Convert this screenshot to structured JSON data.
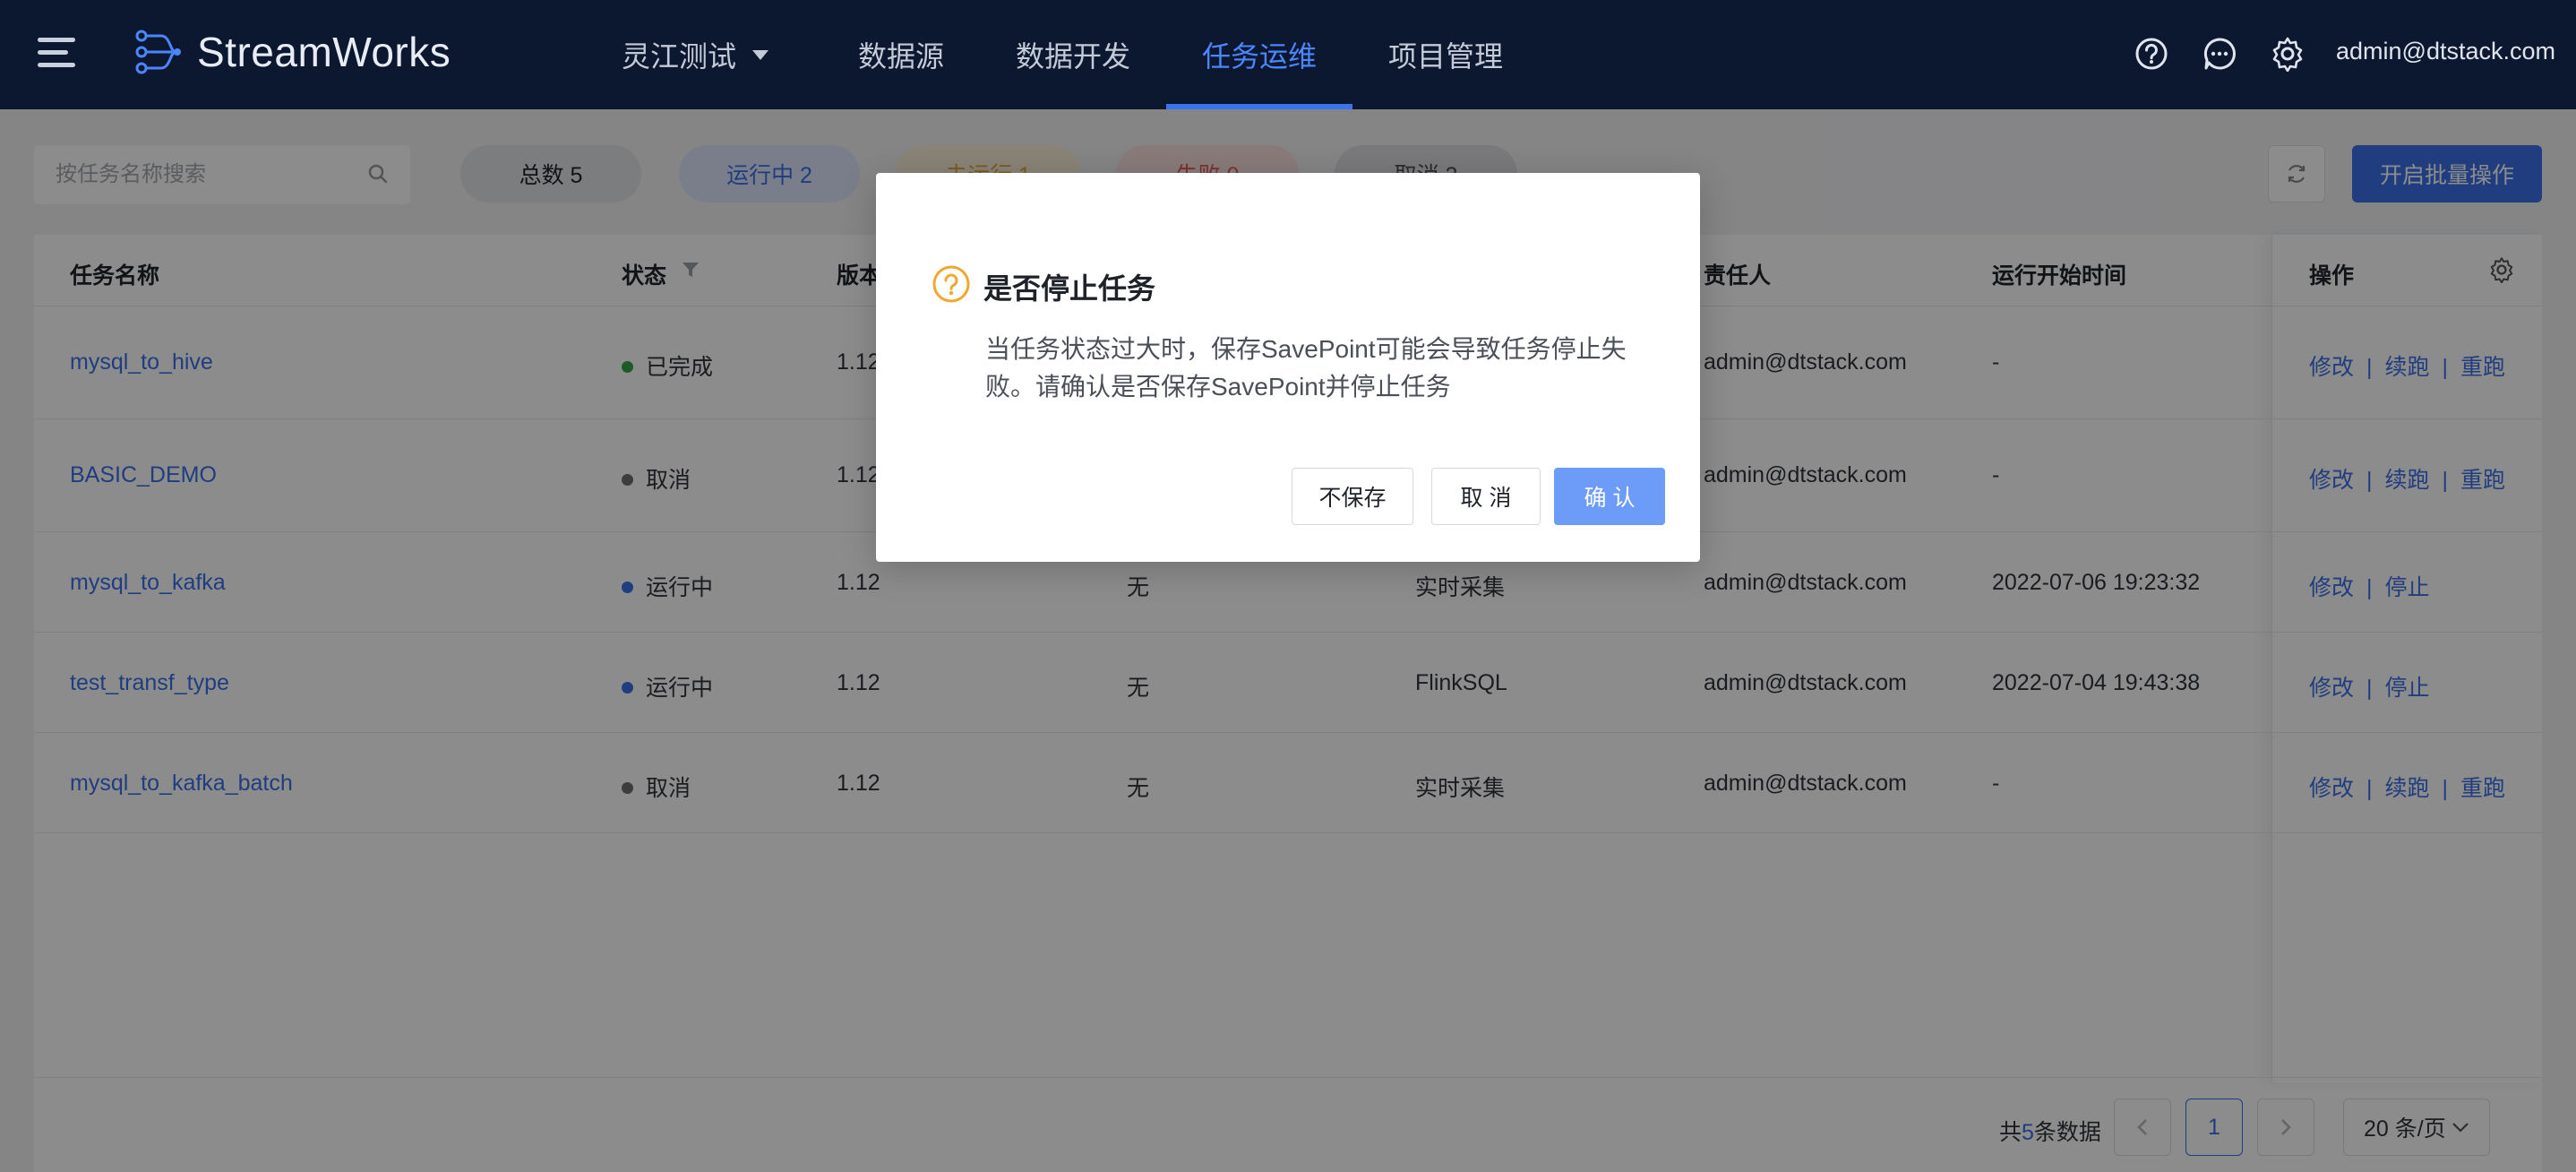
{
  "app": {
    "name": "StreamWorks",
    "user": "admin@dtstack.com"
  },
  "nav": {
    "project": "灵江测试",
    "items": [
      {
        "label": "数据源",
        "active": false
      },
      {
        "label": "数据开发",
        "active": false
      },
      {
        "label": "任务运维",
        "active": true
      },
      {
        "label": "项目管理",
        "active": false
      }
    ]
  },
  "toolbar": {
    "search_placeholder": "按任务名称搜索",
    "filters": [
      {
        "label": "总数 5"
      },
      {
        "label": "运行中 2"
      },
      {
        "label": "未运行 1"
      },
      {
        "label": "失败 0"
      },
      {
        "label": "取消 2"
      }
    ],
    "batch_label": "开启批量操作"
  },
  "table": {
    "columns": [
      "任务名称",
      "状态",
      "版本",
      "责任人",
      "运行开始时间",
      "操作"
    ],
    "rows": [
      {
        "name": "mysql_to_hive",
        "status": "已完成",
        "status_color": "#3ba34a",
        "version": "1.12",
        "col4": "",
        "col5": "",
        "owner": "admin@dtstack.com",
        "start": "-",
        "ops": [
          "修改",
          "续跑",
          "重跑"
        ]
      },
      {
        "name": "BASIC_DEMO",
        "status": "取消",
        "status_color": "#6f6f6f",
        "version": "1.12",
        "col4": "",
        "col5": "",
        "owner": "admin@dtstack.com",
        "start": "-",
        "ops": [
          "修改",
          "续跑",
          "重跑"
        ]
      },
      {
        "name": "mysql_to_kafka",
        "status": "运行中",
        "status_color": "#3b6fe8",
        "version": "1.12",
        "col4": "无",
        "col5": "实时采集",
        "owner": "admin@dtstack.com",
        "start": "2022-07-06 19:23:32",
        "ops": [
          "修改",
          "停止"
        ]
      },
      {
        "name": "test_transf_type",
        "status": "运行中",
        "status_color": "#3b6fe8",
        "version": "1.12",
        "col4": "无",
        "col5": "FlinkSQL",
        "owner": "admin@dtstack.com",
        "start": "2022-07-04 19:43:38",
        "ops": [
          "修改",
          "停止"
        ]
      },
      {
        "name": "mysql_to_kafka_batch",
        "status": "取消",
        "status_color": "#6f6f6f",
        "version": "1.12",
        "col4": "无",
        "col5": "实时采集",
        "owner": "admin@dtstack.com",
        "start": "-",
        "ops": [
          "修改",
          "续跑",
          "重跑"
        ]
      }
    ]
  },
  "pagination": {
    "prefix": "共",
    "total": "5",
    "suffix": "条数据",
    "current": "1",
    "page_size": "20 条/页"
  },
  "modal": {
    "title": "是否停止任务",
    "body": "当任务状态过大时，保存SavePoint可能会导致任务停止失败。请确认是否保存SavePoint并停止任务",
    "buttons": {
      "nosave": "不保存",
      "cancel": "取 消",
      "confirm": "确 认"
    }
  }
}
